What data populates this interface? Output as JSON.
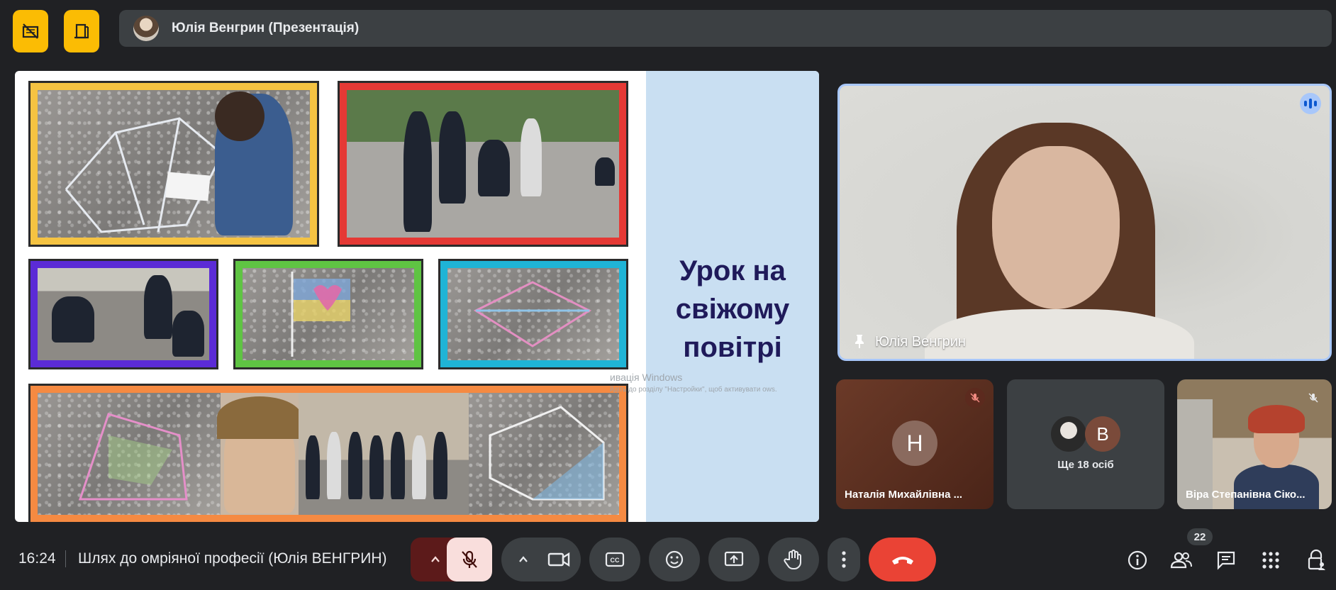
{
  "header": {
    "presenter_name": "Юлія Венгрин (Презентація)"
  },
  "slide": {
    "title_line1": "Урок на",
    "title_line2": "свіжому",
    "title_line3": "повітрі",
    "frame_colors": [
      "#f5c342",
      "#e53935",
      "#5b2bd6",
      "#5fc443",
      "#1fb4d6",
      "#f58a42"
    ]
  },
  "watermark": {
    "line1": "ивація Windows",
    "line2": "йдіть до розділу \"Настройки\", щоб активувати ows."
  },
  "main_tile": {
    "name": "Юлія Венгрин"
  },
  "tiles": [
    {
      "name": "Наталія Михайлівна ...",
      "initial": "Н"
    },
    {
      "label": "Ще 18 осіб",
      "initial": "B"
    },
    {
      "name": "Віра Степанівна Сіко..."
    }
  ],
  "bottom": {
    "time": "16:24",
    "meeting_title": "Шлях до омріяної професії (Юлія ВЕНГРИН)",
    "participants_count": "22"
  },
  "colors": {
    "accent_yellow": "#fbbc04",
    "end_call": "#ea4335",
    "mic_off_bg": "#f9dedc",
    "speaking_border": "#a8c7fa"
  }
}
